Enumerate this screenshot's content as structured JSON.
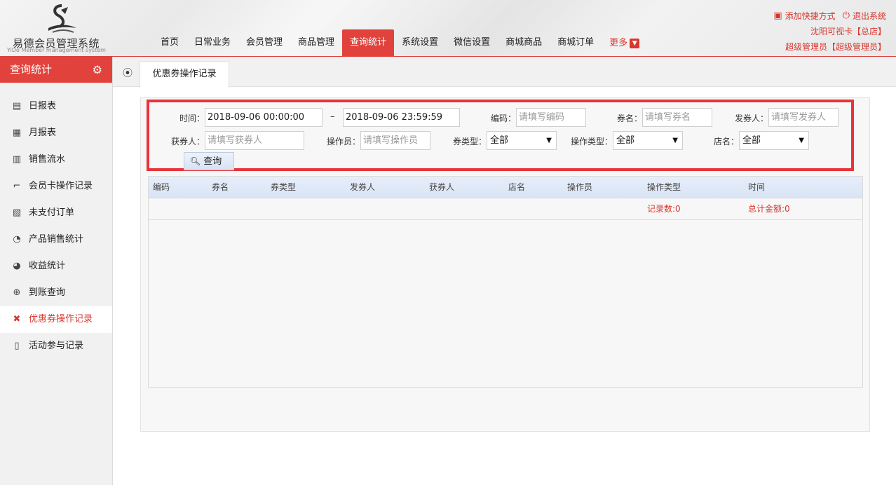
{
  "logo": {
    "title": "易德会员管理系统",
    "subtitle": "YiDe Member management system"
  },
  "nav": {
    "items": [
      "首页",
      "日常业务",
      "会员管理",
      "商品管理",
      "查询统计",
      "系统设置",
      "微信设置",
      "商城商品",
      "商城订单"
    ],
    "active": "查询统计",
    "more": "更多"
  },
  "top_right": {
    "add_shortcut": "添加快捷方式",
    "logout": "退出系统",
    "store": "沈阳可视卡【总店】",
    "user": "超级管理员【超级管理员】"
  },
  "sidebar": {
    "title": "查询统计",
    "items": [
      {
        "label": "日报表",
        "icon": "calendar-icon"
      },
      {
        "label": "月报表",
        "icon": "calendar-month-icon"
      },
      {
        "label": "销售流水",
        "icon": "bar-chart-icon"
      },
      {
        "label": "会员卡操作记录",
        "icon": "crop-icon"
      },
      {
        "label": "未支付订单",
        "icon": "receipt-icon"
      },
      {
        "label": "产品销售统计",
        "icon": "pie-chart-icon"
      },
      {
        "label": "收益统计",
        "icon": "half-circle-icon"
      },
      {
        "label": "到账查询",
        "icon": "crosshair-icon"
      },
      {
        "label": "优惠券操作记录",
        "icon": "coupon-icon",
        "active": true
      },
      {
        "label": "活动参与记录",
        "icon": "map-book-icon"
      }
    ]
  },
  "tab": {
    "label": "优惠券操作记录"
  },
  "filter": {
    "time_label": "时间：",
    "start_time": "2018-09-06 00:00:00",
    "dash": "–",
    "end_time": "2018-09-06 23:59:59",
    "code_label": "编码：",
    "code_placeholder": "请填写编码",
    "name_label": "券名：",
    "name_placeholder": "请填写券名",
    "issuer_label": "发券人：",
    "issuer_placeholder": "请填写发券人",
    "receiver_label": "获券人：",
    "receiver_placeholder": "请填写获券人",
    "operator_label": "操作员：",
    "operator_placeholder": "请填写操作员",
    "type_label": "券类型：",
    "type_value": "全部",
    "op_type_label": "操作类型：",
    "op_type_value": "全部",
    "store_label": "店名：",
    "store_value": "全部",
    "query_button": "查询"
  },
  "table": {
    "columns": [
      "编码",
      "券名",
      "券类型",
      "发券人",
      "获券人",
      "店名",
      "操作员",
      "操作类型",
      "时间"
    ],
    "record_count": "记录数:0",
    "total_amount": "总计金额:0"
  },
  "colors": {
    "accent": "#e1433c",
    "highlight_border": "#e8343b"
  }
}
